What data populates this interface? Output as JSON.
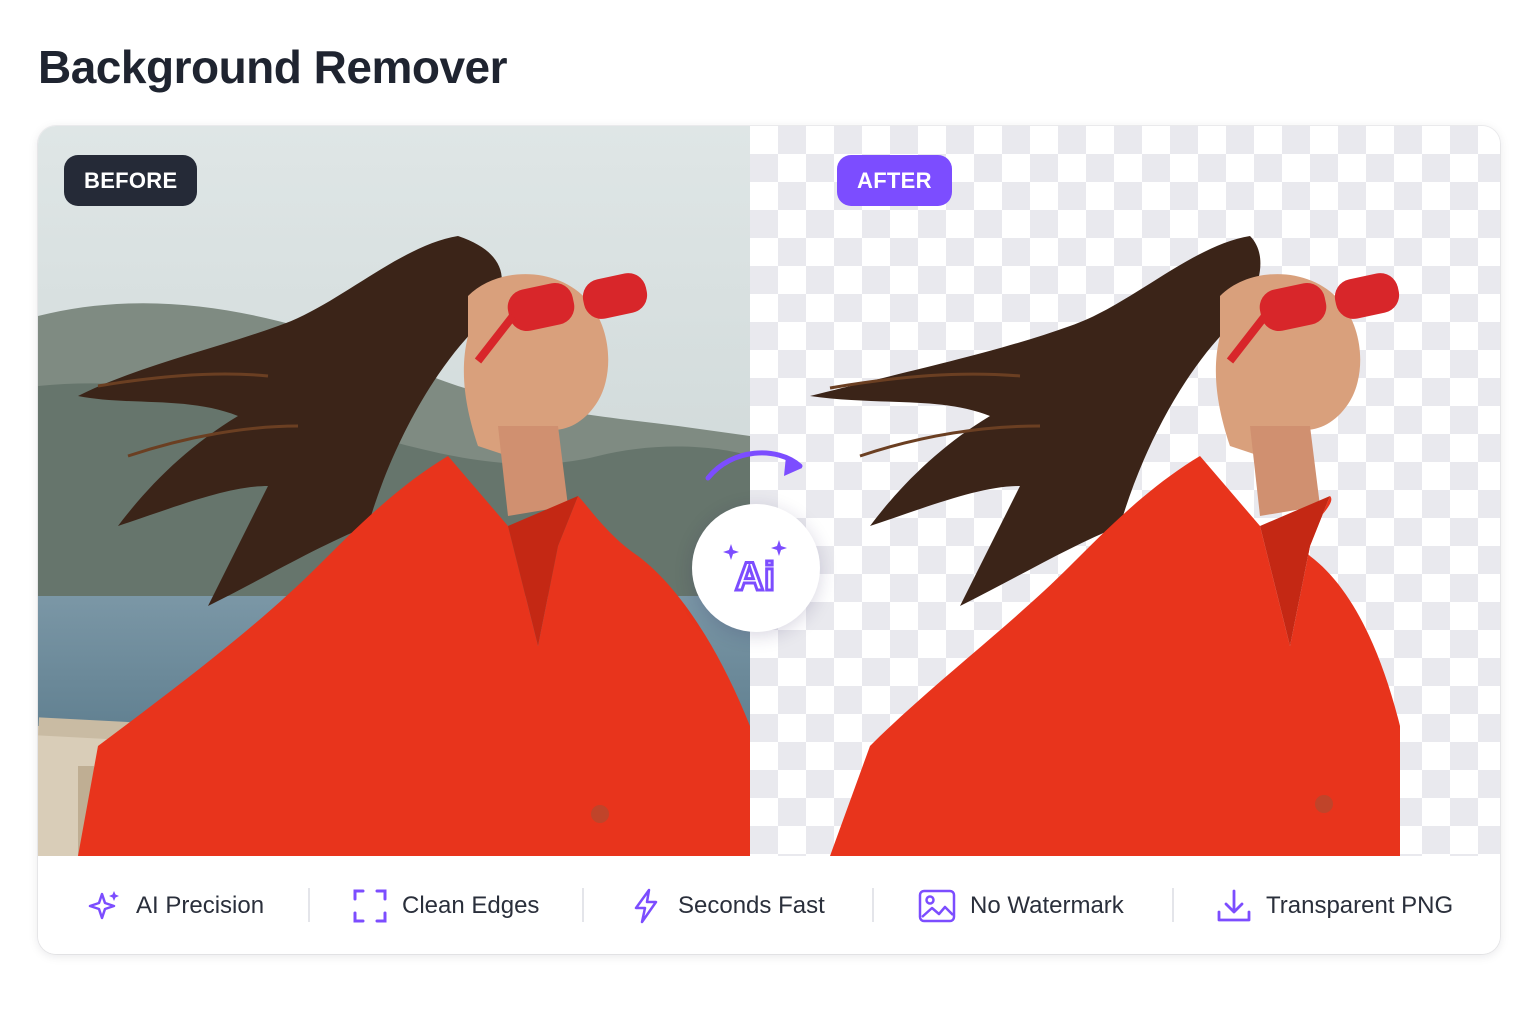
{
  "page": {
    "title": "Background Remover"
  },
  "compare": {
    "before_label": "BEFORE",
    "after_label": "AFTER",
    "ai_label": "Ai"
  },
  "features": [
    {
      "label": "AI Precision",
      "icon": "sparkle-icon"
    },
    {
      "label": "Clean Edges",
      "icon": "crop-frame-icon"
    },
    {
      "label": "Seconds Fast",
      "icon": "lightning-icon"
    },
    {
      "label": "No Watermark",
      "icon": "image-icon"
    },
    {
      "label": "Transparent PNG",
      "icon": "download-icon"
    }
  ],
  "colors": {
    "accent": "#7c4dff",
    "dark_badge": "#252a37",
    "jacket": "#e8341c"
  }
}
